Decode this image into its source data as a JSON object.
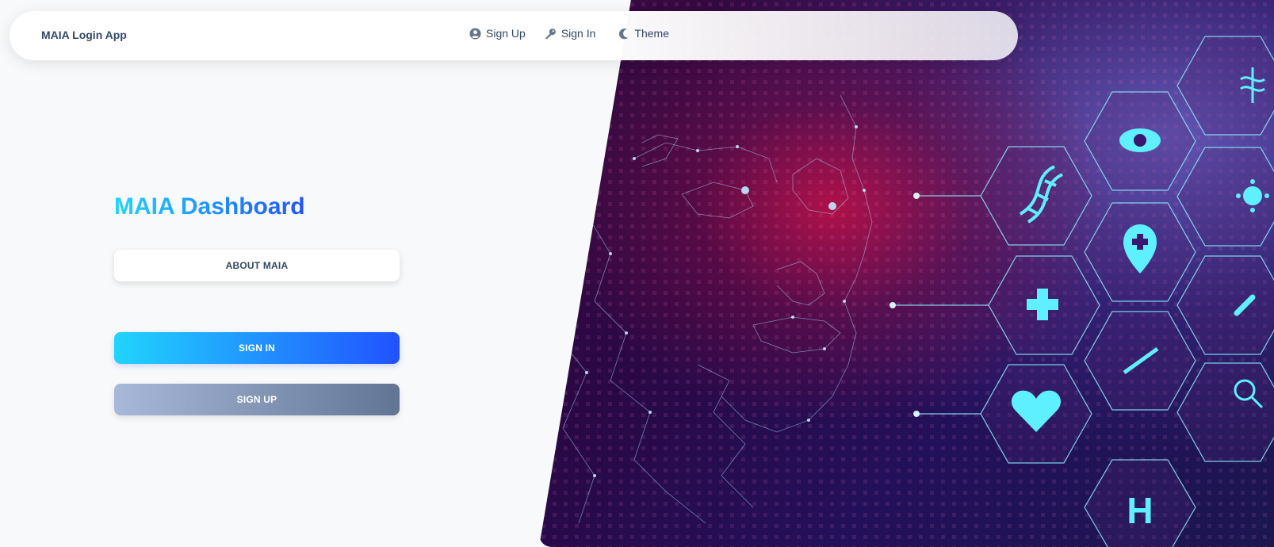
{
  "navbar": {
    "brand": "MAIA Login App",
    "links": [
      {
        "label": "Sign Up",
        "icon": "user-circle-icon"
      },
      {
        "label": "Sign In",
        "icon": "key-icon"
      },
      {
        "label": "Theme",
        "icon": "moon-icon"
      }
    ]
  },
  "main": {
    "title": "MAIA Dashboard",
    "about_label": "ABOUT MAIA",
    "signin_label": "SIGN IN",
    "signup_label": "SIGN UP"
  },
  "hero": {
    "letter": "H",
    "icons": [
      "dna-icon",
      "eye-icon",
      "location-pin-icon",
      "plus-icon",
      "syringe-icon",
      "heart-pulse-icon",
      "hospital-icon",
      "caduceus-icon",
      "virus-icon",
      "pill-icon",
      "magnifier-icon"
    ]
  },
  "colors": {
    "accent_start": "#21d4fd",
    "accent_end": "#2152ff",
    "secondary_start": "#a8b8d8",
    "secondary_end": "#627594",
    "text": "#344767",
    "icon_cyan": "#5ff0ff"
  }
}
